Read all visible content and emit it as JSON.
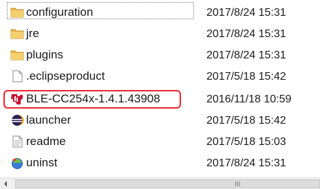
{
  "files": [
    {
      "name": "configuration",
      "date": "2017/8/24 15:31",
      "icon": "folder-icon"
    },
    {
      "name": "jre",
      "date": "2017/8/24 15:31",
      "icon": "folder-icon"
    },
    {
      "name": "plugins",
      "date": "2017/8/24 15:31",
      "icon": "folder-icon"
    },
    {
      "name": ".eclipseproduct",
      "date": "2017/5/18 15:42",
      "icon": "file-icon"
    },
    {
      "name": "BLE-CC254x-1.4.1.43908",
      "date": "2016/11/18 10:59",
      "icon": "ti-logo-icon"
    },
    {
      "name": "launcher",
      "date": "2017/5/18 15:42",
      "icon": "eclipse-icon"
    },
    {
      "name": "readme",
      "date": "2017/5/18 15:03",
      "icon": "document-icon"
    },
    {
      "name": "uninst",
      "date": "2017/8/24 15:31",
      "icon": "uninstall-icon"
    }
  ],
  "colors": {
    "folder": "#e8b64a",
    "highlight": "#e8242b",
    "ti_logo": "#c8102e",
    "eclipse": "#2c2255"
  },
  "scrollbar": {
    "grip": "III"
  }
}
